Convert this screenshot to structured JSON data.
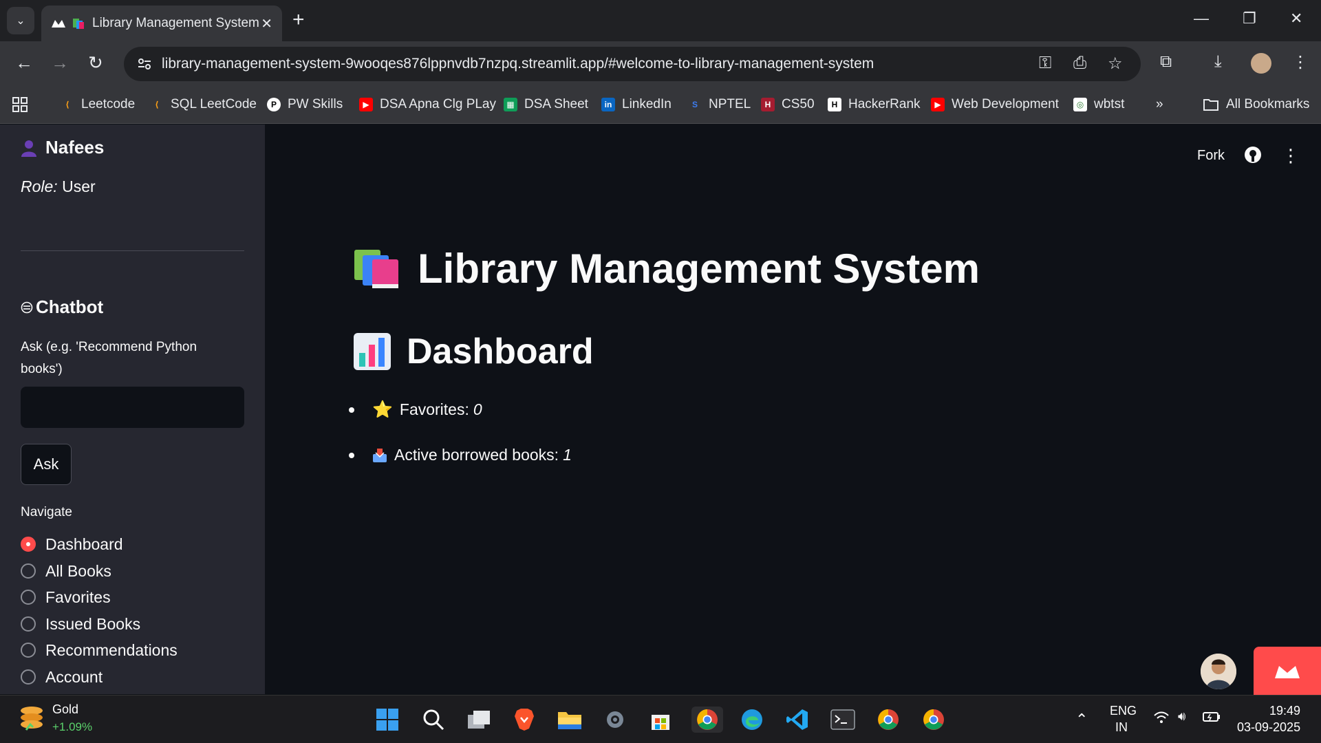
{
  "browser": {
    "tab_title": "Library Management System",
    "url": "library-management-system-9wooqes876lppnvdb7nzpq.streamlit.app/#welcome-to-library-management-system",
    "bookmarks": [
      {
        "label": "Leetcode",
        "icon": "leetcode-icon"
      },
      {
        "label": "SQL LeetCode",
        "icon": "leetcode-icon"
      },
      {
        "label": "PW Skills",
        "icon": "pwskills-icon"
      },
      {
        "label": "DSA Apna Clg PLay",
        "icon": "youtube-icon"
      },
      {
        "label": "DSA Sheet",
        "icon": "sheets-icon"
      },
      {
        "label": "LinkedIn",
        "icon": "linkedin-icon"
      },
      {
        "label": "NPTEL",
        "icon": "nptel-icon"
      },
      {
        "label": "CS50",
        "icon": "harvard-icon"
      },
      {
        "label": "HackerRank",
        "icon": "hackerrank-icon"
      },
      {
        "label": "Web Development",
        "icon": "youtube-icon"
      },
      {
        "label": "wbtst",
        "icon": "wbtst-icon"
      }
    ],
    "all_bookmarks": "All Bookmarks"
  },
  "sidebar": {
    "user_name": "Nafees",
    "role_label": "Role:",
    "role_value": "User",
    "chatbot_title": "Chatbot",
    "ask_label": "Ask (e.g. 'Recommend Python books')",
    "ask_value": "",
    "ask_button": "Ask",
    "navigate_label": "Navigate",
    "nav_items": [
      "Dashboard",
      "All Books",
      "Favorites",
      "Issued Books",
      "Recommendations",
      "Account"
    ],
    "selected_nav": "Dashboard"
  },
  "main": {
    "fork_label": "Fork",
    "title": "Library Management System",
    "subtitle": "Dashboard",
    "favorites_label": "Favorites:",
    "favorites_value": "0",
    "borrowed_label": "Active borrowed books:",
    "borrowed_value": "1"
  },
  "taskbar": {
    "widget_label": "Gold",
    "widget_value": "+1.09%",
    "lang_1": "ENG",
    "lang_2": "IN",
    "time": "19:49",
    "date": "03-09-2025"
  },
  "colors": {
    "accent": "#ff4b4b",
    "sidebar_bg": "#262730",
    "main_bg": "#0e1117"
  }
}
